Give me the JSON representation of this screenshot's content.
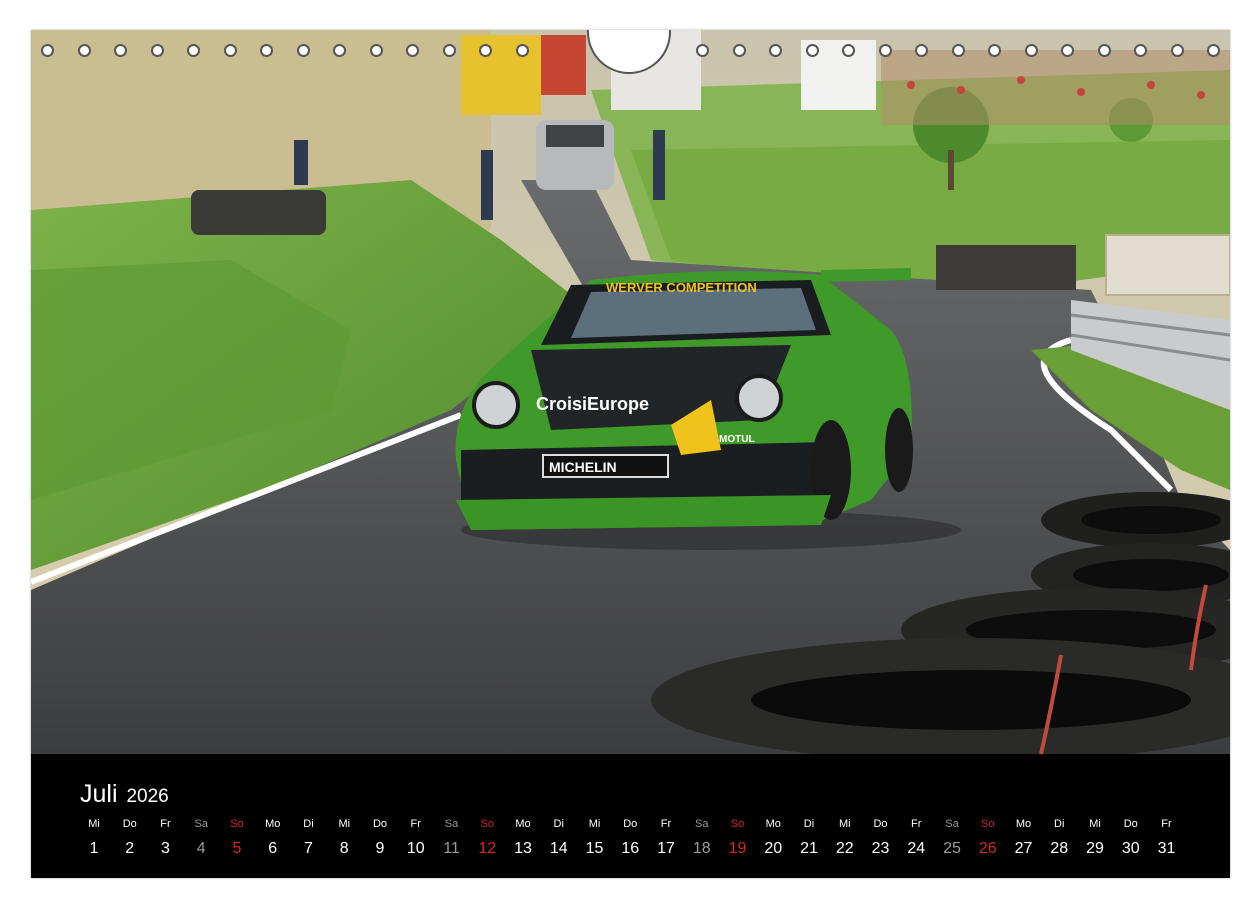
{
  "calendar": {
    "month": "Juli",
    "year": "2026",
    "days": [
      {
        "wd": "Mi",
        "d": "1",
        "t": ""
      },
      {
        "wd": "Do",
        "d": "2",
        "t": ""
      },
      {
        "wd": "Fr",
        "d": "3",
        "t": ""
      },
      {
        "wd": "Sa",
        "d": "4",
        "t": "sat"
      },
      {
        "wd": "So",
        "d": "5",
        "t": "sun"
      },
      {
        "wd": "Mo",
        "d": "6",
        "t": ""
      },
      {
        "wd": "Di",
        "d": "7",
        "t": ""
      },
      {
        "wd": "Mi",
        "d": "8",
        "t": ""
      },
      {
        "wd": "Do",
        "d": "9",
        "t": ""
      },
      {
        "wd": "Fr",
        "d": "10",
        "t": ""
      },
      {
        "wd": "Sa",
        "d": "11",
        "t": "sat"
      },
      {
        "wd": "So",
        "d": "12",
        "t": "sun"
      },
      {
        "wd": "Mo",
        "d": "13",
        "t": ""
      },
      {
        "wd": "Di",
        "d": "14",
        "t": ""
      },
      {
        "wd": "Mi",
        "d": "15",
        "t": ""
      },
      {
        "wd": "Do",
        "d": "16",
        "t": ""
      },
      {
        "wd": "Fr",
        "d": "17",
        "t": ""
      },
      {
        "wd": "Sa",
        "d": "18",
        "t": "sat"
      },
      {
        "wd": "So",
        "d": "19",
        "t": "sun"
      },
      {
        "wd": "Mo",
        "d": "20",
        "t": ""
      },
      {
        "wd": "Di",
        "d": "21",
        "t": ""
      },
      {
        "wd": "Mi",
        "d": "22",
        "t": ""
      },
      {
        "wd": "Do",
        "d": "23",
        "t": ""
      },
      {
        "wd": "Fr",
        "d": "24",
        "t": ""
      },
      {
        "wd": "Sa",
        "d": "25",
        "t": "sat"
      },
      {
        "wd": "So",
        "d": "26",
        "t": "sun"
      },
      {
        "wd": "Mo",
        "d": "27",
        "t": ""
      },
      {
        "wd": "Di",
        "d": "28",
        "t": ""
      },
      {
        "wd": "Mi",
        "d": "29",
        "t": ""
      },
      {
        "wd": "Do",
        "d": "30",
        "t": ""
      },
      {
        "wd": "Fr",
        "d": "31",
        "t": ""
      }
    ]
  },
  "photo": {
    "car_text": {
      "sponsor_top": "WERVER COMPETITION",
      "hood_1": "CroisiEurope",
      "bumper": "MICHELIN",
      "badge": "MOTUL"
    }
  },
  "colors": {
    "weekday": "#ffffff",
    "saturday": "#9a9a9a",
    "sunday": "#d9262b",
    "car_green": "#3f9a2a",
    "asphalt": "#4a4b4d",
    "grass": "#6fa83b"
  }
}
